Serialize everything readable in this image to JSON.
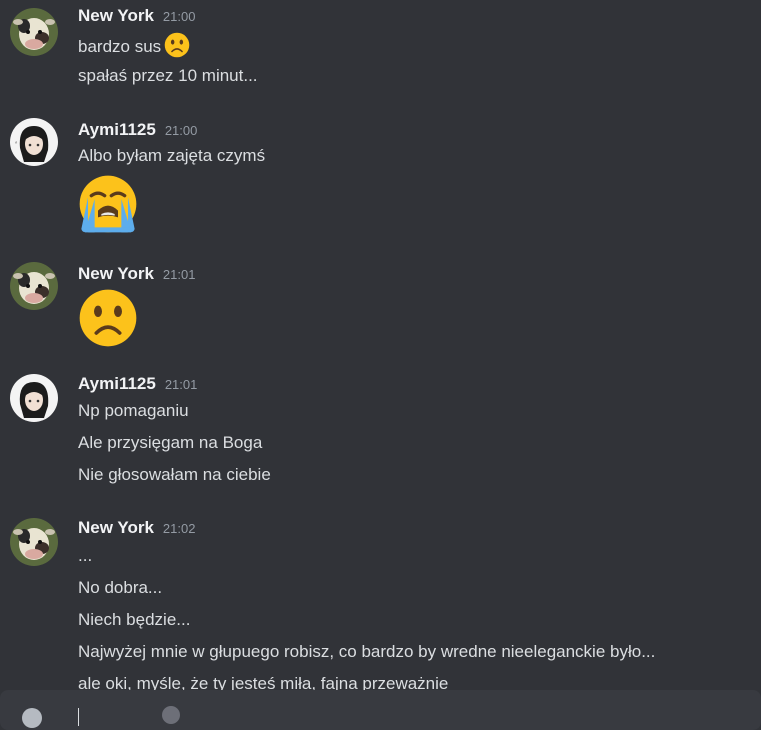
{
  "messages": [
    {
      "username": "New York",
      "timestamp": "21:00",
      "avatar": "cow-avatar",
      "lines": [
        "bardzo sus",
        "spałaś przez 10 minut..."
      ],
      "inline_emoji": "slightly-frowning-face-emoji"
    },
    {
      "username": "Aymi1125",
      "timestamp": "21:00",
      "avatar": "anime-girl-avatar",
      "lines": [
        "Albo byłam zajęta czymś"
      ],
      "jumbo_emoji": "loudly-crying-face-emoji"
    },
    {
      "username": "New York",
      "timestamp": "21:01",
      "avatar": "cow-avatar",
      "lines": [],
      "jumbo_emoji": "slightly-frowning-face-emoji"
    },
    {
      "username": "Aymi1125",
      "timestamp": "21:01",
      "avatar": "anime-girl-avatar",
      "lines": [
        "Np pomaganiu",
        "Ale przysięgam na Boga",
        "Nie głosowałam na ciebie"
      ]
    },
    {
      "username": "New York",
      "timestamp": "21:02",
      "avatar": "cow-avatar",
      "lines": [
        "...",
        "No dobra...",
        "Niech będzie...",
        "Najwyżej mnie w głupuego robisz, co bardzo by wredne nieeleganckie było...",
        "ale oki, myśle, że ty jesteś miła, fajna przeważnie"
      ]
    }
  ],
  "composer": {
    "placeholder": ""
  },
  "colors": {
    "background": "#313338",
    "username": "#f2f3f5",
    "timestamp": "#949ba4",
    "text": "#dbdee1",
    "emoji": "#fcc21b"
  }
}
